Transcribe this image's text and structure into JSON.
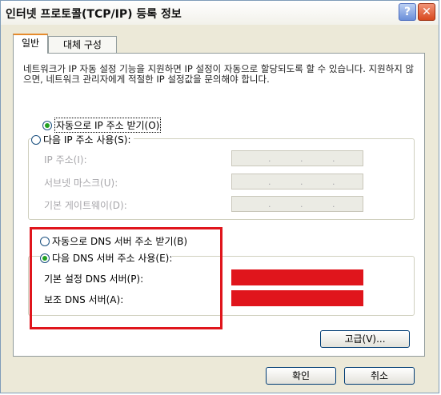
{
  "window": {
    "title": "인터넷 프로토콜(TCP/IP) 등록 정보",
    "help_button": "?",
    "close_button": "✕"
  },
  "tabs": [
    {
      "label": "일반",
      "active": true
    },
    {
      "label": "대체 구성",
      "active": false
    }
  ],
  "description": "네트워크가 IP 자동 설정 기능을 지원하면 IP 설정이 자동으로 할당되도록 할 수 있습니다. 지원하지 않으면, 네트워크 관리자에게 적절한 IP 설정값을 문의해야 합니다.",
  "ip": {
    "auto_label": "자동으로 IP 주소 받기(O)",
    "auto_selected": true,
    "manual_label": "다음 IP 주소 사용(S):",
    "manual_selected": false,
    "fields": {
      "address_label": "IP 주소(I):",
      "subnet_label": "서브넷 마스크(U):",
      "gateway_label": "기본 게이트웨이(D):",
      "dot": "."
    }
  },
  "dns": {
    "auto_label": "자동으로 DNS 서버 주소 받기(B)",
    "auto_selected": false,
    "manual_label": "다음 DNS 서버 주소 사용(E):",
    "manual_selected": true,
    "preferred_label": "기본 설정 DNS 서버(P):",
    "alternate_label": "보조 DNS 서버(A):",
    "redaction_color": "#e0151c"
  },
  "buttons": {
    "advanced": "고급(V)...",
    "ok": "확인",
    "cancel": "취소"
  }
}
